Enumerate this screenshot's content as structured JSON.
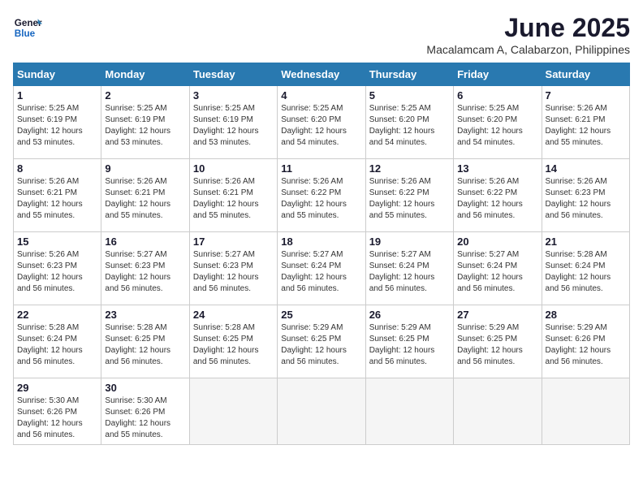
{
  "logo": {
    "line1": "General",
    "line2": "Blue"
  },
  "title": "June 2025",
  "subtitle": "Macalamcam A, Calabarzon, Philippines",
  "weekdays": [
    "Sunday",
    "Monday",
    "Tuesday",
    "Wednesday",
    "Thursday",
    "Friday",
    "Saturday"
  ],
  "weeks": [
    [
      {
        "day": "1",
        "sunrise": "Sunrise: 5:25 AM",
        "sunset": "Sunset: 6:19 PM",
        "daylight": "Daylight: 12 hours and 53 minutes."
      },
      {
        "day": "2",
        "sunrise": "Sunrise: 5:25 AM",
        "sunset": "Sunset: 6:19 PM",
        "daylight": "Daylight: 12 hours and 53 minutes."
      },
      {
        "day": "3",
        "sunrise": "Sunrise: 5:25 AM",
        "sunset": "Sunset: 6:19 PM",
        "daylight": "Daylight: 12 hours and 53 minutes."
      },
      {
        "day": "4",
        "sunrise": "Sunrise: 5:25 AM",
        "sunset": "Sunset: 6:20 PM",
        "daylight": "Daylight: 12 hours and 54 minutes."
      },
      {
        "day": "5",
        "sunrise": "Sunrise: 5:25 AM",
        "sunset": "Sunset: 6:20 PM",
        "daylight": "Daylight: 12 hours and 54 minutes."
      },
      {
        "day": "6",
        "sunrise": "Sunrise: 5:25 AM",
        "sunset": "Sunset: 6:20 PM",
        "daylight": "Daylight: 12 hours and 54 minutes."
      },
      {
        "day": "7",
        "sunrise": "Sunrise: 5:26 AM",
        "sunset": "Sunset: 6:21 PM",
        "daylight": "Daylight: 12 hours and 55 minutes."
      }
    ],
    [
      {
        "day": "8",
        "sunrise": "Sunrise: 5:26 AM",
        "sunset": "Sunset: 6:21 PM",
        "daylight": "Daylight: 12 hours and 55 minutes."
      },
      {
        "day": "9",
        "sunrise": "Sunrise: 5:26 AM",
        "sunset": "Sunset: 6:21 PM",
        "daylight": "Daylight: 12 hours and 55 minutes."
      },
      {
        "day": "10",
        "sunrise": "Sunrise: 5:26 AM",
        "sunset": "Sunset: 6:21 PM",
        "daylight": "Daylight: 12 hours and 55 minutes."
      },
      {
        "day": "11",
        "sunrise": "Sunrise: 5:26 AM",
        "sunset": "Sunset: 6:22 PM",
        "daylight": "Daylight: 12 hours and 55 minutes."
      },
      {
        "day": "12",
        "sunrise": "Sunrise: 5:26 AM",
        "sunset": "Sunset: 6:22 PM",
        "daylight": "Daylight: 12 hours and 55 minutes."
      },
      {
        "day": "13",
        "sunrise": "Sunrise: 5:26 AM",
        "sunset": "Sunset: 6:22 PM",
        "daylight": "Daylight: 12 hours and 56 minutes."
      },
      {
        "day": "14",
        "sunrise": "Sunrise: 5:26 AM",
        "sunset": "Sunset: 6:23 PM",
        "daylight": "Daylight: 12 hours and 56 minutes."
      }
    ],
    [
      {
        "day": "15",
        "sunrise": "Sunrise: 5:26 AM",
        "sunset": "Sunset: 6:23 PM",
        "daylight": "Daylight: 12 hours and 56 minutes."
      },
      {
        "day": "16",
        "sunrise": "Sunrise: 5:27 AM",
        "sunset": "Sunset: 6:23 PM",
        "daylight": "Daylight: 12 hours and 56 minutes."
      },
      {
        "day": "17",
        "sunrise": "Sunrise: 5:27 AM",
        "sunset": "Sunset: 6:23 PM",
        "daylight": "Daylight: 12 hours and 56 minutes."
      },
      {
        "day": "18",
        "sunrise": "Sunrise: 5:27 AM",
        "sunset": "Sunset: 6:24 PM",
        "daylight": "Daylight: 12 hours and 56 minutes."
      },
      {
        "day": "19",
        "sunrise": "Sunrise: 5:27 AM",
        "sunset": "Sunset: 6:24 PM",
        "daylight": "Daylight: 12 hours and 56 minutes."
      },
      {
        "day": "20",
        "sunrise": "Sunrise: 5:27 AM",
        "sunset": "Sunset: 6:24 PM",
        "daylight": "Daylight: 12 hours and 56 minutes."
      },
      {
        "day": "21",
        "sunrise": "Sunrise: 5:28 AM",
        "sunset": "Sunset: 6:24 PM",
        "daylight": "Daylight: 12 hours and 56 minutes."
      }
    ],
    [
      {
        "day": "22",
        "sunrise": "Sunrise: 5:28 AM",
        "sunset": "Sunset: 6:24 PM",
        "daylight": "Daylight: 12 hours and 56 minutes."
      },
      {
        "day": "23",
        "sunrise": "Sunrise: 5:28 AM",
        "sunset": "Sunset: 6:25 PM",
        "daylight": "Daylight: 12 hours and 56 minutes."
      },
      {
        "day": "24",
        "sunrise": "Sunrise: 5:28 AM",
        "sunset": "Sunset: 6:25 PM",
        "daylight": "Daylight: 12 hours and 56 minutes."
      },
      {
        "day": "25",
        "sunrise": "Sunrise: 5:29 AM",
        "sunset": "Sunset: 6:25 PM",
        "daylight": "Daylight: 12 hours and 56 minutes."
      },
      {
        "day": "26",
        "sunrise": "Sunrise: 5:29 AM",
        "sunset": "Sunset: 6:25 PM",
        "daylight": "Daylight: 12 hours and 56 minutes."
      },
      {
        "day": "27",
        "sunrise": "Sunrise: 5:29 AM",
        "sunset": "Sunset: 6:25 PM",
        "daylight": "Daylight: 12 hours and 56 minutes."
      },
      {
        "day": "28",
        "sunrise": "Sunrise: 5:29 AM",
        "sunset": "Sunset: 6:26 PM",
        "daylight": "Daylight: 12 hours and 56 minutes."
      }
    ],
    [
      {
        "day": "29",
        "sunrise": "Sunrise: 5:30 AM",
        "sunset": "Sunset: 6:26 PM",
        "daylight": "Daylight: 12 hours and 56 minutes."
      },
      {
        "day": "30",
        "sunrise": "Sunrise: 5:30 AM",
        "sunset": "Sunset: 6:26 PM",
        "daylight": "Daylight: 12 hours and 55 minutes."
      },
      null,
      null,
      null,
      null,
      null
    ]
  ]
}
